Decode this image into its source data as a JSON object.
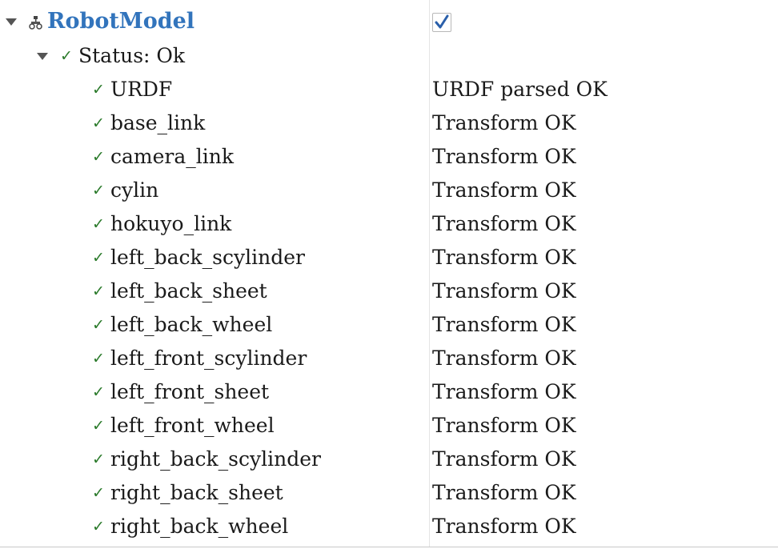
{
  "root": {
    "title": "RobotModel",
    "enabled": true,
    "icon": "robot-model-icon"
  },
  "status": {
    "label": "Status: Ok"
  },
  "items": [
    {
      "name": "URDF",
      "value": "URDF parsed OK"
    },
    {
      "name": "base_link",
      "value": "Transform OK"
    },
    {
      "name": "camera_link",
      "value": "Transform OK"
    },
    {
      "name": "cylin",
      "value": "Transform OK"
    },
    {
      "name": "hokuyo_link",
      "value": "Transform OK"
    },
    {
      "name": "left_back_scylinder",
      "value": "Transform OK"
    },
    {
      "name": "left_back_sheet",
      "value": "Transform OK"
    },
    {
      "name": "left_back_wheel",
      "value": "Transform OK"
    },
    {
      "name": "left_front_scylinder",
      "value": "Transform OK"
    },
    {
      "name": "left_front_sheet",
      "value": "Transform OK"
    },
    {
      "name": "left_front_wheel",
      "value": "Transform OK"
    },
    {
      "name": "right_back_scylinder",
      "value": "Transform OK"
    },
    {
      "name": "right_back_sheet",
      "value": "Transform OK"
    },
    {
      "name": "right_back_wheel",
      "value": "Transform OK"
    }
  ],
  "colors": {
    "title": "#3274bc",
    "check": "#2a7a2a",
    "checkbox_mark": "#2a5faa"
  }
}
